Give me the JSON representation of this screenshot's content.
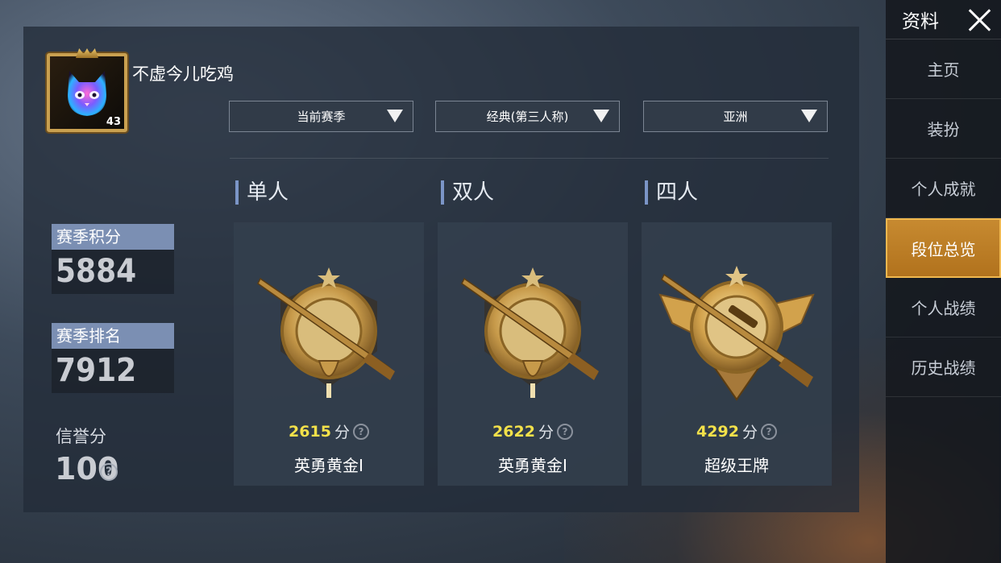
{
  "profile": {
    "username": "不虚今儿吃鸡",
    "level": "43"
  },
  "filters": [
    {
      "label": "当前赛季"
    },
    {
      "label": "经典(第三人称)"
    },
    {
      "label": "亚洲"
    }
  ],
  "stats": {
    "season_points_label": "赛季积分",
    "season_points": "5884",
    "season_rank_label": "赛季排名",
    "season_rank": "7912",
    "credit_label": "信誉分",
    "credit_value": "100",
    "help_glyph": "?"
  },
  "modes": [
    {
      "title": "单人",
      "score": "2615",
      "unit": "分",
      "rank": "英勇黄金Ⅰ",
      "badge": "gold"
    },
    {
      "title": "双人",
      "score": "2622",
      "unit": "分",
      "rank": "英勇黄金Ⅰ",
      "badge": "gold"
    },
    {
      "title": "四人",
      "score": "4292",
      "unit": "分",
      "rank": "超级王牌",
      "badge": "ace"
    }
  ],
  "sidebar": {
    "title": "资料",
    "items": [
      {
        "label": "主页"
      },
      {
        "label": "装扮"
      },
      {
        "label": "个人成就"
      },
      {
        "label": "段位总览"
      },
      {
        "label": "个人战绩"
      },
      {
        "label": "历史战绩"
      }
    ],
    "active_index": 3
  },
  "colors": {
    "accent": "#c78a30",
    "label_bg": "#7b8fb3",
    "score_highlight": "#f3e14a"
  }
}
